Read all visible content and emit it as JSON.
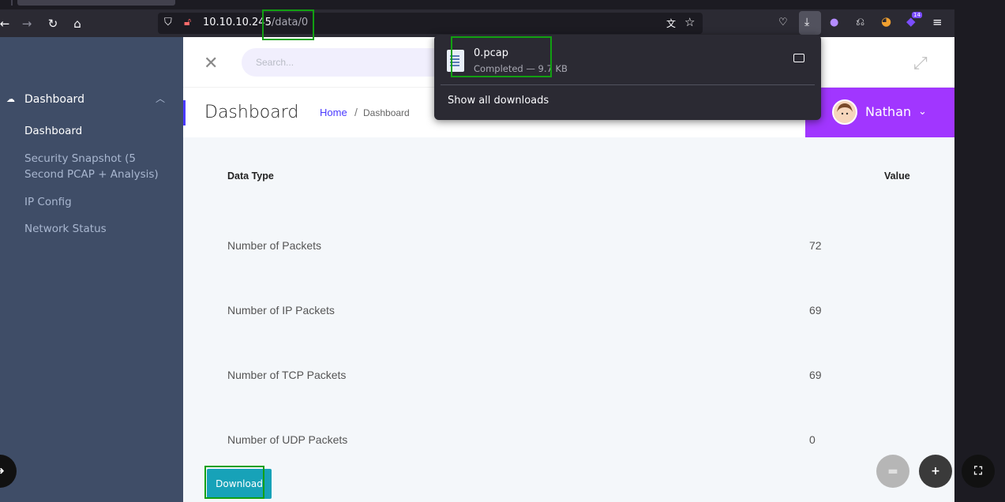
{
  "browser": {
    "url_host": "10.10.10.245",
    "url_path": "/data/0"
  },
  "downloads_panel": {
    "filename": "0.pcap",
    "status": "Completed — 9.7 KB",
    "show_all_label": "Show all downloads"
  },
  "sidebar": {
    "section_label": "Dashboard",
    "items": [
      {
        "label": "Dashboard"
      },
      {
        "label": "Security Snapshot (5 Second PCAP + Analysis)"
      },
      {
        "label": "IP Config"
      },
      {
        "label": "Network Status"
      }
    ]
  },
  "header": {
    "search_placeholder": "Search..."
  },
  "page": {
    "title": "Dashboard",
    "breadcrumb_home": "Home",
    "breadcrumb_sep": "/",
    "breadcrumb_current": "Dashboard"
  },
  "user": {
    "name": "Nathan"
  },
  "table": {
    "headers": [
      "Data Type",
      "Value"
    ],
    "rows": [
      {
        "label": "Number of Packets",
        "value": "72"
      },
      {
        "label": "Number of IP Packets",
        "value": "69"
      },
      {
        "label": "Number of TCP Packets",
        "value": "69"
      },
      {
        "label": "Number of UDP Packets",
        "value": "0"
      }
    ]
  },
  "download_button_label": "Download",
  "notification_badge": "14",
  "colors": {
    "accent": "#4a3aff",
    "user_box": "#a136ff",
    "download_button": "#17a2b8",
    "sidebar": "#3f4d67",
    "highlight": "#12a012"
  }
}
